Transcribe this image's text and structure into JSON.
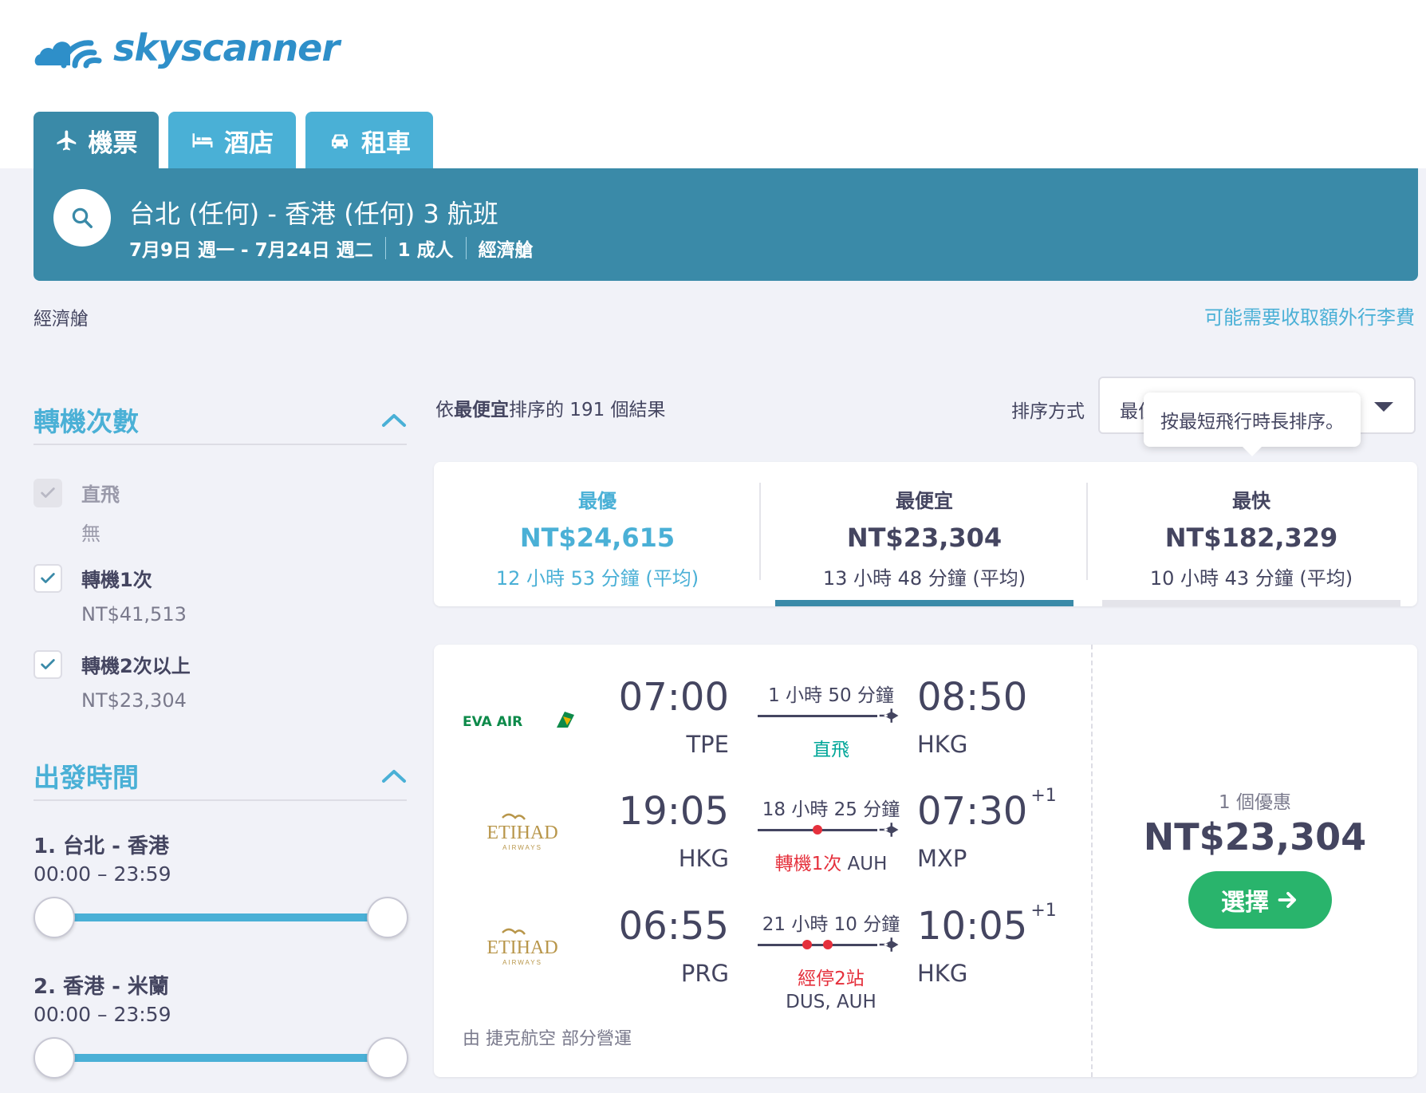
{
  "brand": {
    "name": "skyscanner",
    "color": "#2e8fc9"
  },
  "tabs": [
    {
      "label": "機票",
      "icon": "plane-icon",
      "active": true
    },
    {
      "label": "酒店",
      "icon": "bed-icon",
      "active": false
    },
    {
      "label": "租車",
      "icon": "car-icon",
      "active": false
    }
  ],
  "search": {
    "route": "台北 (任何) - 香港 (任何) 3 航班",
    "dates": "7月9日 週一 - 7月24日 週二",
    "passengers": "1 成人",
    "cabin": "經濟艙"
  },
  "cabin_label": "經濟艙",
  "baggage_link": "可能需要收取額外行李費",
  "filters": {
    "stops": {
      "title": "轉機次數",
      "options": [
        {
          "label": "直飛",
          "price": "無",
          "checked": true,
          "disabled": true
        },
        {
          "label": "轉機1次",
          "price": "NT$41,513",
          "checked": true,
          "disabled": false
        },
        {
          "label": "轉機2次以上",
          "price": "NT$23,304",
          "checked": true,
          "disabled": false
        }
      ]
    },
    "departure": {
      "title": "出發時間",
      "legs": [
        {
          "label": "1. 台北 - 香港",
          "range": "00:00 – 23:59",
          "min_fraction": 0,
          "max_fraction": 1
        },
        {
          "label": "2. 香港 - 米蘭",
          "range": "00:00 – 23:59",
          "min_fraction": 0,
          "max_fraction": 1
        }
      ]
    }
  },
  "results": {
    "count_prefix": "依",
    "count_bold": "最便宜",
    "count_suffix": "排序的 191 個結果",
    "sort_label": "排序方式",
    "sort_value": "最佳",
    "tooltip": "按最短飛行時長排序。"
  },
  "summary_cards": [
    {
      "heading": "最優",
      "price": "NT$24,615",
      "duration": "12 小時 53 分鐘 (平均)",
      "selected": false
    },
    {
      "heading": "最便宜",
      "price": "NT$23,304",
      "duration": "13 小時 48 分鐘 (平均)",
      "selected": true
    },
    {
      "heading": "最快",
      "price": "NT$182,329",
      "duration": "10 小時 43 分鐘 (平均)",
      "selected": false
    }
  ],
  "itinerary": {
    "legs": [
      {
        "airline": "EVA AIR",
        "dep_time": "07:00",
        "dep_code": "TPE",
        "duration": "1 小時 50 分鐘",
        "stops": "直飛",
        "stop_via": "",
        "via": "",
        "arr_time": "08:50",
        "arr_offset": "",
        "arr_code": "HKG",
        "stop_count": 0
      },
      {
        "airline": "ETIHAD",
        "airline_sub": "AIRWAYS",
        "dep_time": "19:05",
        "dep_code": "HKG",
        "duration": "18 小時 25 分鐘",
        "stops": "轉機1次",
        "stop_via": " AUH",
        "via": "",
        "arr_time": "07:30",
        "arr_offset": "+1",
        "arr_code": "MXP",
        "stop_count": 1
      },
      {
        "airline": "ETIHAD",
        "airline_sub": "AIRWAYS",
        "dep_time": "06:55",
        "dep_code": "PRG",
        "duration": "21 小時 10 分鐘",
        "stops": "經停2站",
        "stop_via": "",
        "via": "DUS, AUH",
        "arr_time": "10:05",
        "arr_offset": "+1",
        "arr_code": "HKG",
        "stop_count": 2
      }
    ],
    "operated_by": "由 捷克航空 部分營運",
    "deal_count": "1 個優惠",
    "price": "NT$23,304",
    "select_label": "選擇"
  },
  "colors": {
    "primary": "#3a8aa8",
    "accent": "#4ab0d6",
    "select": "#29b46c",
    "stop_red": "#e5303c",
    "direct_green": "#00a698"
  }
}
